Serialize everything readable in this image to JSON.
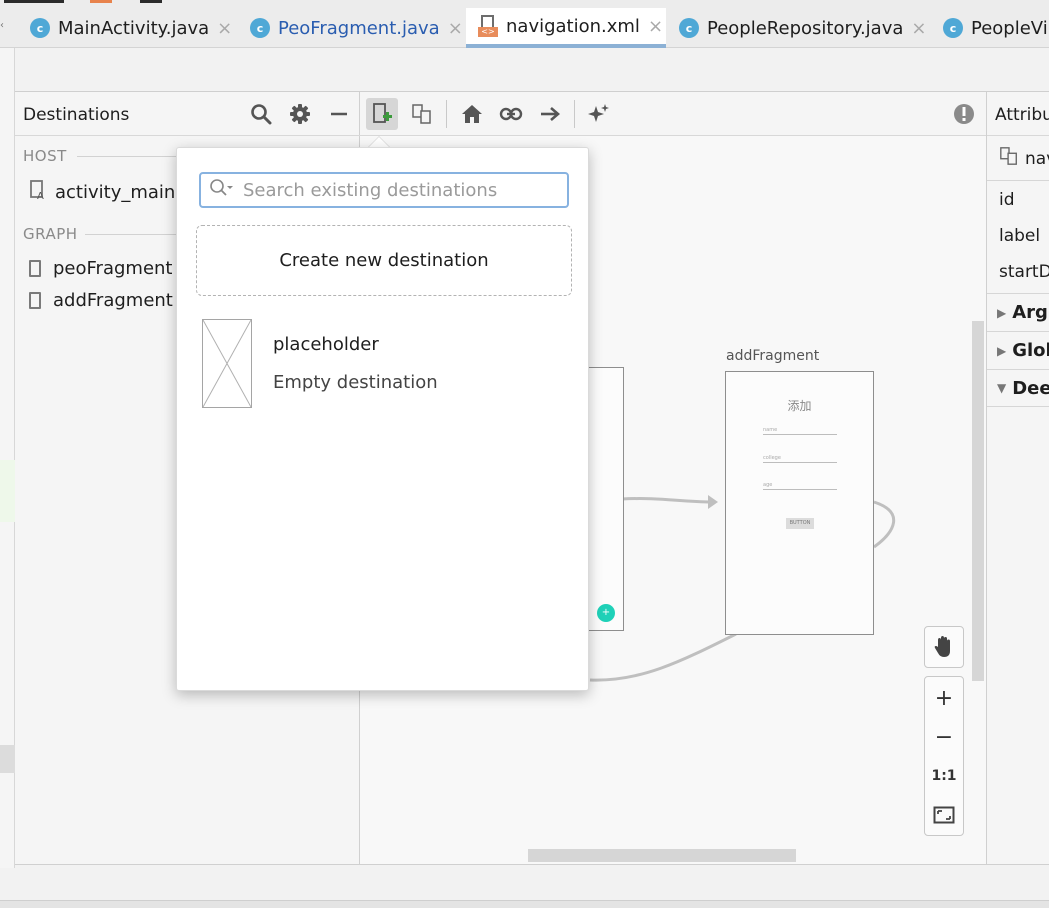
{
  "tabs": [
    {
      "label": "MainActivity.java",
      "icon": "class-icon",
      "icon_letter": "c",
      "active": false,
      "color": "#1e1e1e"
    },
    {
      "label": "PeoFragment.java",
      "icon": "class-icon",
      "icon_letter": "c",
      "active": false,
      "color": "#2a5db0"
    },
    {
      "label": "navigation.xml",
      "icon": "xml-file-icon",
      "icon_tag": "<>",
      "active": true,
      "color": "#1e1e1e"
    },
    {
      "label": "PeopleRepository.java",
      "icon": "class-icon",
      "icon_letter": "c",
      "active": false,
      "color": "#1e1e1e"
    },
    {
      "label": "PeopleVi",
      "icon": "class-icon",
      "icon_letter": "c",
      "active": false,
      "color": "#1e1e1e"
    }
  ],
  "destinations": {
    "title": "Destinations",
    "host_label": "HOST",
    "host_items": [
      "activity_main ("
    ],
    "graph_label": "GRAPH",
    "graph_items": [
      "peoFragment",
      "addFragment"
    ]
  },
  "canvas": {
    "fragment_label": "addFragment",
    "fragment_title": "添加",
    "field_hints": [
      "name",
      "college",
      "age"
    ],
    "button_text": "BUTTON"
  },
  "attributes": {
    "title": "Attribu",
    "nav_label": "nav",
    "rows": [
      "id",
      "label",
      "startD"
    ],
    "sections": [
      {
        "label": "Argu",
        "expanded": false
      },
      {
        "label": "Glob",
        "expanded": false
      },
      {
        "label": "Dee",
        "expanded": true
      }
    ]
  },
  "zoom": {
    "actual_size_label": "1:1"
  },
  "popup": {
    "search_placeholder": "Search existing destinations",
    "create_label": "Create new destination",
    "placeholder_name": "placeholder",
    "placeholder_desc": "Empty destination"
  },
  "colors": {
    "accent_blue": "#87b2e0",
    "class_icon": "#4fa8d6",
    "xml_tag": "#e88c5b",
    "fab": "#1fd1b8"
  }
}
